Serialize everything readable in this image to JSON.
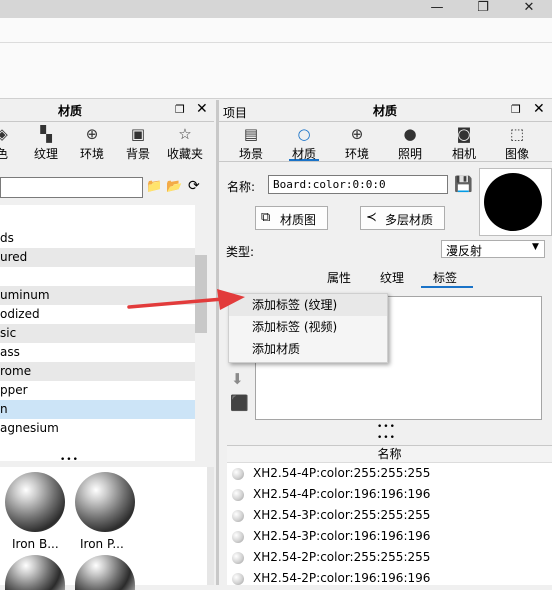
{
  "window": {
    "minimize": "—",
    "restore": "❐",
    "close": "✕"
  },
  "left_panel": {
    "title": "材质",
    "tabs": [
      {
        "label": "色",
        "icon": "color-icon"
      },
      {
        "label": "纹理",
        "icon": "texture-icon"
      },
      {
        "label": "环境",
        "icon": "globe-icon"
      },
      {
        "label": "背景",
        "icon": "image-icon"
      },
      {
        "label": "收藏夹",
        "icon": "star-icon"
      }
    ],
    "list": [
      "ds",
      "ured",
      "",
      "uminum",
      "odized",
      "sic",
      "ass",
      "rome",
      "pper",
      "n",
      "agnesium"
    ],
    "selected_index": 9,
    "thumbnails": [
      "Iron B...",
      "Iron P..."
    ],
    "splitter": "•••"
  },
  "right_panel": {
    "project_label": "项目",
    "title": "材质",
    "tabs": [
      {
        "label": "场景",
        "icon": "scene-icon"
      },
      {
        "label": "材质",
        "icon": "material-icon"
      },
      {
        "label": "环境",
        "icon": "globe-icon"
      },
      {
        "label": "照明",
        "icon": "bulb-icon"
      },
      {
        "label": "相机",
        "icon": "camera-icon"
      },
      {
        "label": "图像",
        "icon": "crop-icon"
      }
    ],
    "active_tab": 1,
    "name_label": "名称:",
    "name_value": "Board:color:0:0:0",
    "material_graph_button": "材质图",
    "multilayer_button": "多层材质",
    "type_label": "类型:",
    "type_value": "漫反射",
    "subtabs": [
      "属性",
      "纹理",
      "标签"
    ],
    "active_subtab": 2,
    "context_menu": [
      "添加标签 (纹理)",
      "添加标签 (视频)",
      "添加材质"
    ],
    "list_header": "名称",
    "materials": [
      "XH2.54-4P:color:255:255:255",
      "XH2.54-4P:color:196:196:196",
      "XH2.54-3P:color:255:255:255",
      "XH2.54-3P:color:196:196:196",
      "XH2.54-2P:color:255:255:255",
      "XH2.54-2P:color:196:196:196"
    ],
    "preview_color": "#000000",
    "accent_color": "#1a73c8"
  }
}
